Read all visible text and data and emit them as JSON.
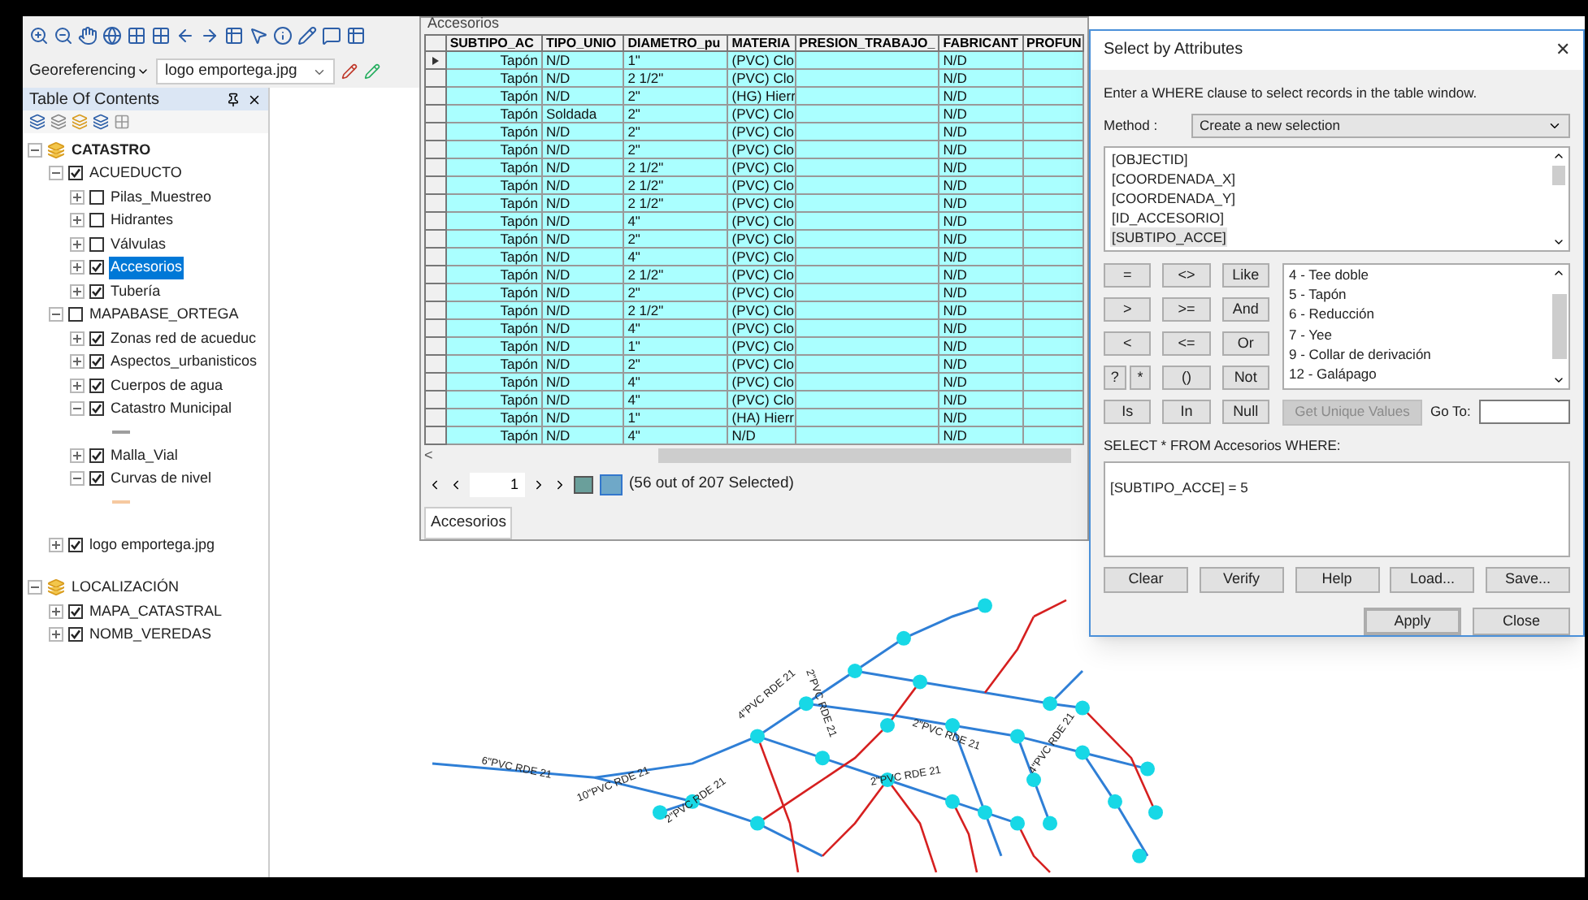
{
  "toolbar": {
    "georeferencing_menu": "Georeferencing",
    "layer_combo": "logo emportega.jpg"
  },
  "toc": {
    "title": "Table Of Contents",
    "items": [
      {
        "label": "CATASTRO",
        "kind": "frame",
        "active": true,
        "expanded": true,
        "children": [
          {
            "label": "ACUEDUCTO",
            "kind": "layer",
            "checked": true,
            "expanded": true,
            "selected": false,
            "children": [
              {
                "label": "Pilas_Muestreo",
                "kind": "layer",
                "checked": false,
                "expanded": false,
                "selected": false
              },
              {
                "label": "Hidrantes",
                "kind": "layer",
                "checked": false,
                "expanded": false,
                "selected": false
              },
              {
                "label": "Válvulas",
                "kind": "layer",
                "checked": false,
                "expanded": false,
                "selected": false
              },
              {
                "label": "Accesorios",
                "kind": "layer",
                "checked": true,
                "expanded": false,
                "selected": true
              },
              {
                "label": "Tubería",
                "kind": "layer",
                "checked": true,
                "expanded": false,
                "selected": false
              }
            ]
          },
          {
            "label": "MAPABASE_ORTEGA",
            "kind": "layer",
            "checked": false,
            "expanded": true,
            "selected": false,
            "children": [
              {
                "label": "Zonas red de acueduc",
                "kind": "layer",
                "checked": true,
                "expanded": false,
                "selected": false
              },
              {
                "label": "Aspectos_urbanisticos",
                "kind": "layer",
                "checked": true,
                "expanded": false,
                "selected": false
              },
              {
                "label": "Cuerpos de agua",
                "kind": "layer",
                "checked": true,
                "expanded": false,
                "selected": false
              },
              {
                "label": "Catastro Municipal",
                "kind": "layer",
                "checked": true,
                "expanded": true,
                "selected": false,
                "color": "#9e9e9e"
              },
              {
                "label": "Malla_Vial",
                "kind": "layer",
                "checked": true,
                "expanded": false,
                "selected": false
              },
              {
                "label": "Curvas de nivel",
                "kind": "layer",
                "checked": true,
                "expanded": true,
                "selected": false,
                "color": "#f6c9a0"
              }
            ]
          },
          {
            "label": "logo emportega.jpg",
            "kind": "layer",
            "checked": true,
            "expanded": false,
            "selected": false
          }
        ]
      },
      {
        "label": "LOCALIZACIÓN",
        "kind": "frame",
        "active": false,
        "expanded": true,
        "children": [
          {
            "label": "MAPA_CATASTRAL",
            "kind": "layer",
            "checked": true,
            "expanded": false,
            "selected": false
          },
          {
            "label": "NOMB_VEREDAS",
            "kind": "layer",
            "checked": true,
            "expanded": false,
            "selected": false
          }
        ]
      }
    ]
  },
  "table": {
    "title": "Accesorios",
    "columns": [
      "SUBTIPO_AC",
      "TIPO_UNIO",
      "DIAMETRO_pu",
      "MATERIA",
      "PRESION_TRABAJO_",
      "FABRICANT",
      "PROFUN"
    ],
    "rows": [
      {
        "subtipo": "Tapón",
        "union": "N/D",
        "diametro": "1\"",
        "materia": "(PVC) Clo",
        "fabricante": "N/D",
        "selected": true,
        "current": true
      },
      {
        "subtipo": "Tapón",
        "union": "N/D",
        "diametro": "2 1/2\"",
        "materia": "(PVC) Clo",
        "fabricante": "N/D",
        "selected": true,
        "current": false
      },
      {
        "subtipo": "Tapón",
        "union": "N/D",
        "diametro": "2\"",
        "materia": "(HG) Hierr",
        "fabricante": "N/D",
        "selected": true,
        "current": false
      },
      {
        "subtipo": "Tapón",
        "union": "Soldada",
        "diametro": "2\"",
        "materia": "(PVC) Clo",
        "fabricante": "N/D",
        "selected": true,
        "current": false
      },
      {
        "subtipo": "Tapón",
        "union": "N/D",
        "diametro": "2\"",
        "materia": "(PVC) Clo",
        "fabricante": "N/D",
        "selected": true,
        "current": false
      },
      {
        "subtipo": "Tapón",
        "union": "N/D",
        "diametro": "2\"",
        "materia": "(PVC) Clo",
        "fabricante": "N/D",
        "selected": true,
        "current": false
      },
      {
        "subtipo": "Tapón",
        "union": "N/D",
        "diametro": "2 1/2\"",
        "materia": "(PVC) Clo",
        "fabricante": "N/D",
        "selected": true,
        "current": false
      },
      {
        "subtipo": "Tapón",
        "union": "N/D",
        "diametro": "2 1/2\"",
        "materia": "(PVC) Clo",
        "fabricante": "N/D",
        "selected": true,
        "current": false
      },
      {
        "subtipo": "Tapón",
        "union": "N/D",
        "diametro": "2 1/2\"",
        "materia": "(PVC) Clo",
        "fabricante": "N/D",
        "selected": true,
        "current": false
      },
      {
        "subtipo": "Tapón",
        "union": "N/D",
        "diametro": "4\"",
        "materia": "(PVC) Clo",
        "fabricante": "N/D",
        "selected": true,
        "current": false
      },
      {
        "subtipo": "Tapón",
        "union": "N/D",
        "diametro": "2\"",
        "materia": "(PVC) Clo",
        "fabricante": "N/D",
        "selected": true,
        "current": false
      },
      {
        "subtipo": "Tapón",
        "union": "N/D",
        "diametro": "4\"",
        "materia": "(PVC) Clo",
        "fabricante": "N/D",
        "selected": true,
        "current": false
      },
      {
        "subtipo": "Tapón",
        "union": "N/D",
        "diametro": "2 1/2\"",
        "materia": "(PVC) Clo",
        "fabricante": "N/D",
        "selected": true,
        "current": false
      },
      {
        "subtipo": "Tapón",
        "union": "N/D",
        "diametro": "2\"",
        "materia": "(PVC) Clo",
        "fabricante": "N/D",
        "selected": true,
        "current": false
      },
      {
        "subtipo": "Tapón",
        "union": "N/D",
        "diametro": "2 1/2\"",
        "materia": "(PVC) Clo",
        "fabricante": "N/D",
        "selected": true,
        "current": false
      },
      {
        "subtipo": "Tapón",
        "union": "N/D",
        "diametro": "4\"",
        "materia": "(PVC) Clo",
        "fabricante": "N/D",
        "selected": true,
        "current": false
      },
      {
        "subtipo": "Tapón",
        "union": "N/D",
        "diametro": "1\"",
        "materia": "(PVC) Clo",
        "fabricante": "N/D",
        "selected": true,
        "current": false
      },
      {
        "subtipo": "Tapón",
        "union": "N/D",
        "diametro": "2\"",
        "materia": "(PVC) Clo",
        "fabricante": "N/D",
        "selected": true,
        "current": false
      },
      {
        "subtipo": "Tapón",
        "union": "N/D",
        "diametro": "4\"",
        "materia": "(PVC) Clo",
        "fabricante": "N/D",
        "selected": true,
        "current": false
      },
      {
        "subtipo": "Tapón",
        "union": "N/D",
        "diametro": "4\"",
        "materia": "(PVC) Clo",
        "fabricante": "N/D",
        "selected": true,
        "current": false
      },
      {
        "subtipo": "Tapón",
        "union": "N/D",
        "diametro": "1\"",
        "materia": "(HA) Hierr",
        "fabricante": "N/D",
        "selected": true,
        "current": false
      },
      {
        "subtipo": "Tapón",
        "union": "N/D",
        "diametro": "4\"",
        "materia": "N/D",
        "fabricante": "N/D",
        "selected": true,
        "current": false
      }
    ],
    "scroll_left": "<",
    "page": "1",
    "status": "(56 out of 207 Selected)",
    "tab": "Accesorios"
  },
  "dialog": {
    "title": "Select by Attributes",
    "close": "✕",
    "instruction": "Enter a WHERE clause to select records in the table window.",
    "method_label": "Method :",
    "method": "Create a new selection",
    "fields": [
      {
        "label": "[OBJECTID]",
        "selected": false
      },
      {
        "label": "[COORDENADA_X]",
        "selected": false
      },
      {
        "label": "[COORDENADA_Y]",
        "selected": false
      },
      {
        "label": "[ID_ACCESORIO]",
        "selected": false
      },
      {
        "label": "[SUBTIPO_ACCE]",
        "selected": true
      }
    ],
    "operators": [
      "=",
      "<>",
      "Like",
      ">",
      ">=",
      "And",
      "<",
      "<=",
      "Or",
      "?",
      "*",
      "()",
      "Not",
      "Is",
      "In",
      "Null"
    ],
    "values": [
      "4 - Tee doble",
      "5 - Tapón",
      "6 - Reducción",
      "7 - Yee",
      "9 - Collar de derivación",
      "12 - Galápago"
    ],
    "unique_button": {
      "label": "Get Unique Values",
      "disabled": true
    },
    "goto_label": "Go To:",
    "query_label": "SELECT * FROM Accesorios WHERE:",
    "query": "[SUBTIPO_ACCE] = 5",
    "buttons": [
      "Clear",
      "Verify",
      "Help",
      "Load...",
      "Save..."
    ],
    "apply": "Apply",
    "close_button": "Close"
  },
  "map": {
    "labels": [
      "6\"PVC RDE 21",
      "10\"PVC RDE 21",
      "2\"PVC RDE 21",
      "4\"PVC RDE 21",
      "2\"PVC RDE 21",
      "2\"PVC RDE 21",
      "4\"PVC RDE 21",
      "2\"PVC RDE 21"
    ]
  }
}
